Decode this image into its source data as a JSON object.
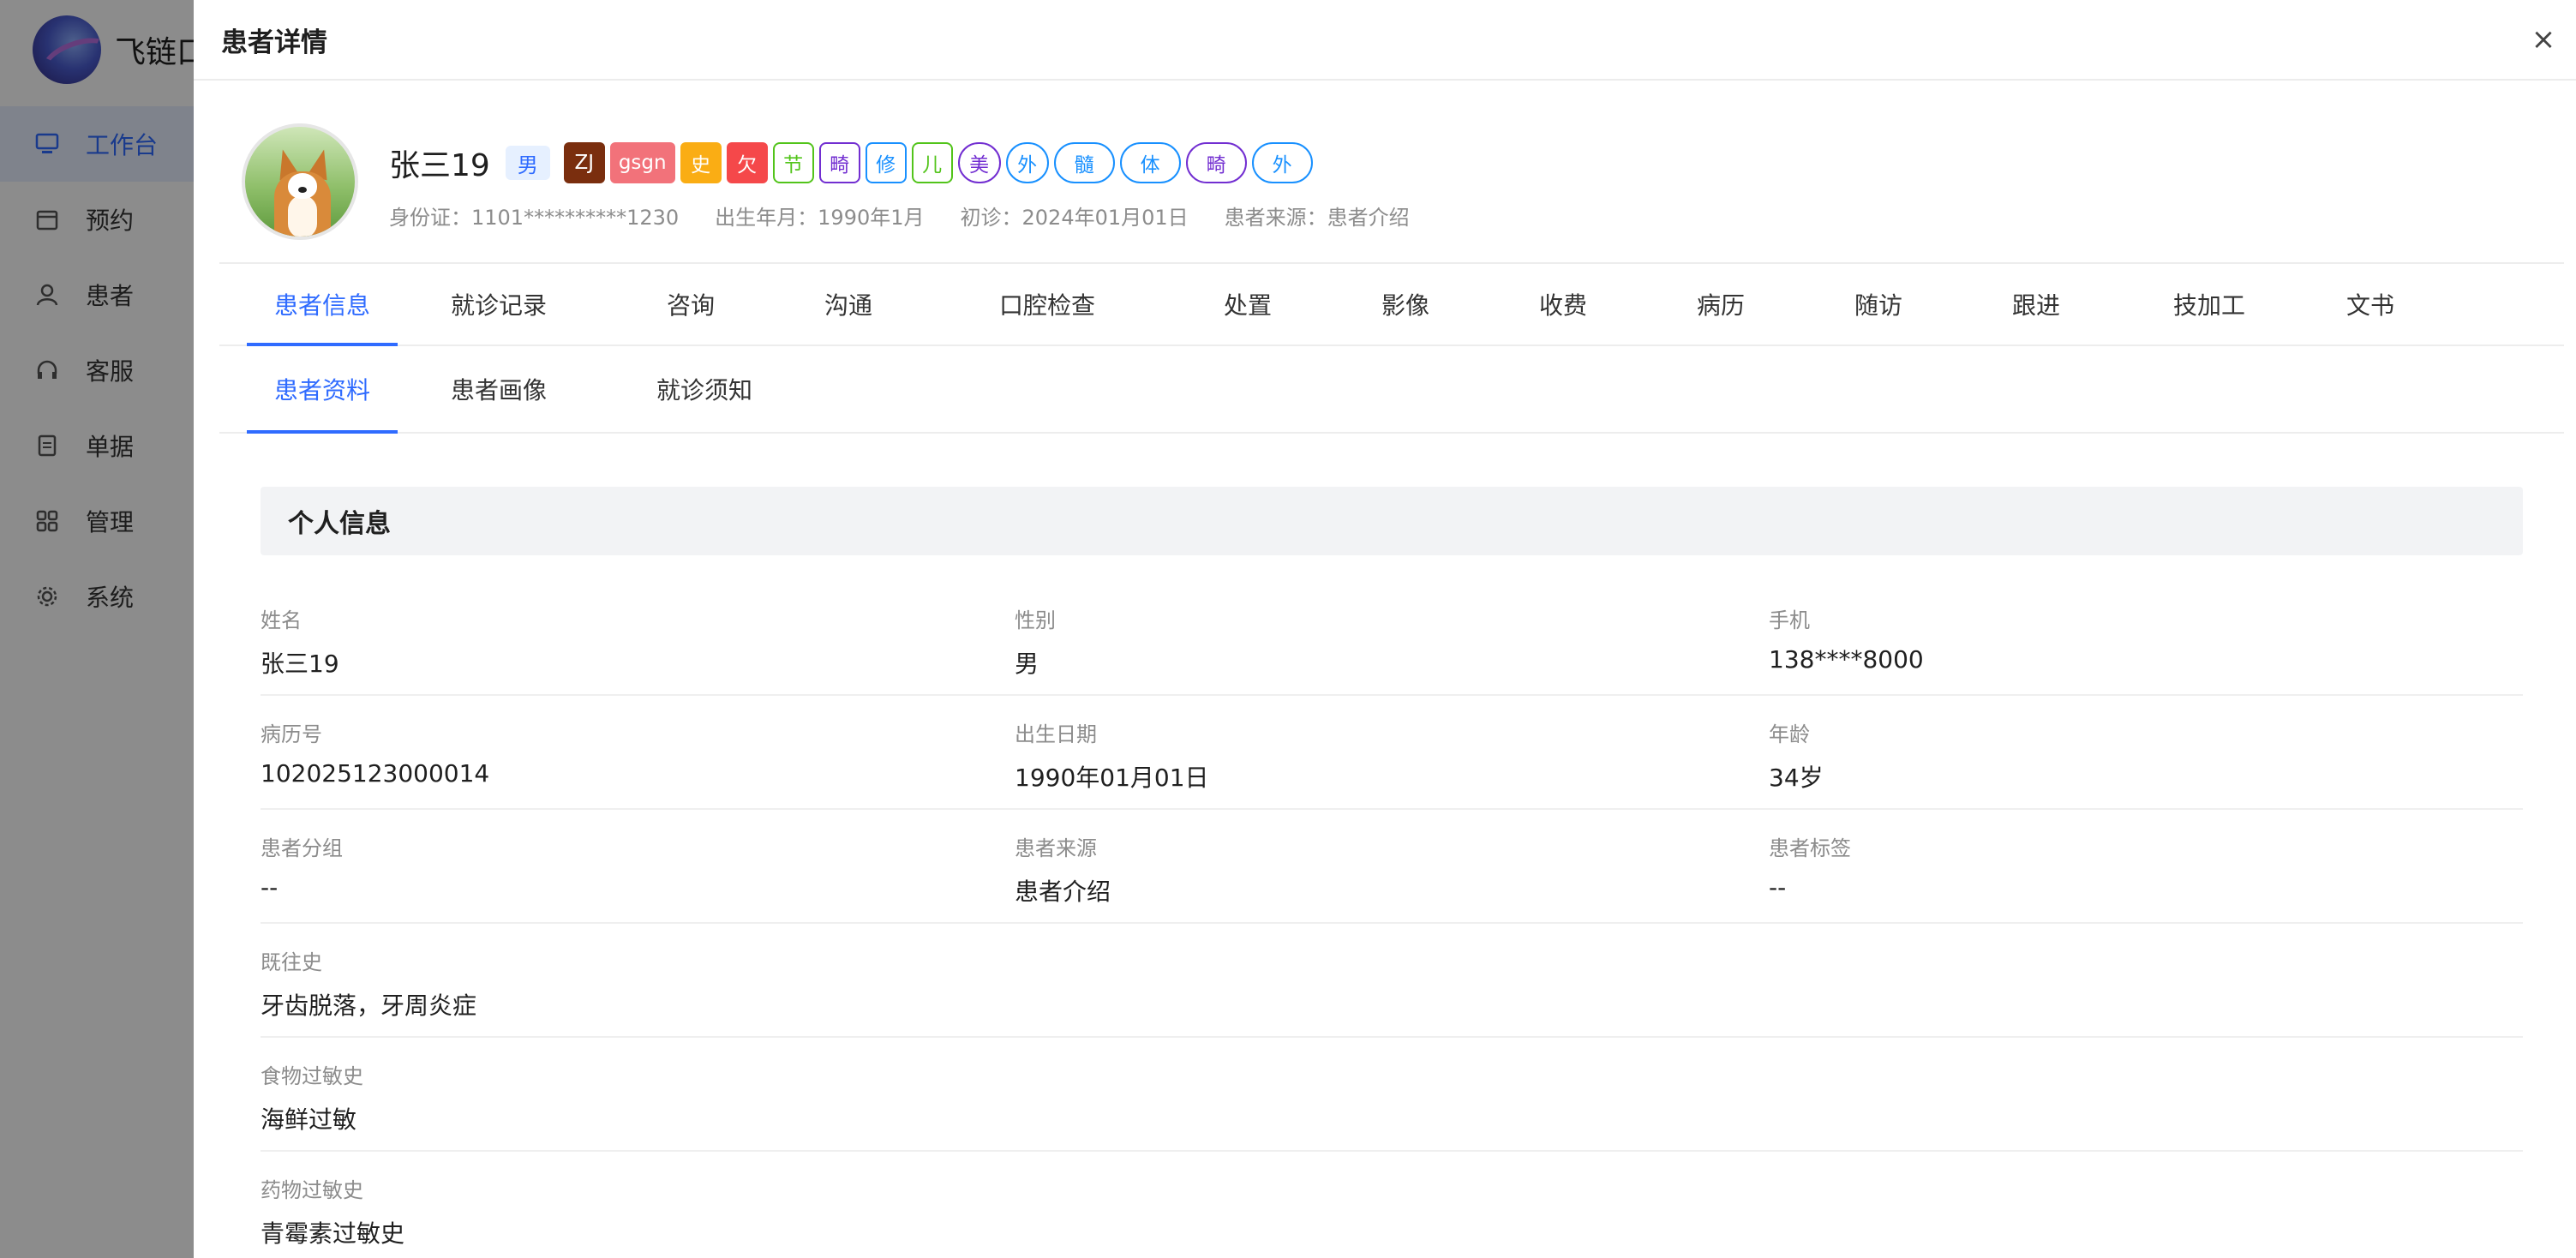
{
  "app": {
    "logo_text": "飞链口",
    "nav": [
      {
        "label": "工作台",
        "icon": "monitor-icon"
      },
      {
        "label": "预约",
        "icon": "calendar-icon"
      },
      {
        "label": "患者",
        "icon": "user-icon"
      },
      {
        "label": "客服",
        "icon": "headset-icon"
      },
      {
        "label": "单据",
        "icon": "document-icon"
      },
      {
        "label": "管理",
        "icon": "grid-icon"
      },
      {
        "label": "系统",
        "icon": "gear-icon"
      }
    ]
  },
  "drawer": {
    "title": "患者详情",
    "close_label": "×"
  },
  "patient": {
    "name": "张三19",
    "gender": "男",
    "tags": [
      {
        "text": "ZJ",
        "style": "solid",
        "color": "#7a2e0e"
      },
      {
        "text": "gsgn",
        "style": "solid",
        "color": "#f2727a"
      },
      {
        "text": "史",
        "style": "solid",
        "color": "#faad14"
      },
      {
        "text": "欠",
        "style": "solid",
        "color": "#f5484a"
      },
      {
        "text": "节",
        "style": "outline",
        "color": "#52c41a"
      },
      {
        "text": "畸",
        "style": "outline",
        "color": "#722ed1"
      },
      {
        "text": "修",
        "style": "outline",
        "color": "#1890ff"
      },
      {
        "text": "儿",
        "style": "outline",
        "color": "#52c41a"
      },
      {
        "text": "美",
        "style": "circle",
        "color": "#722ed1"
      },
      {
        "text": "外",
        "style": "circle",
        "color": "#1890ff"
      },
      {
        "text": "髓",
        "style": "pill",
        "color": "#1890ff"
      },
      {
        "text": "体",
        "style": "pill",
        "color": "#1890ff"
      },
      {
        "text": "畸",
        "style": "pill",
        "color": "#722ed1"
      },
      {
        "text": "外",
        "style": "pill",
        "color": "#1890ff"
      }
    ],
    "meta": {
      "id_card": "身份证：1101**********1230",
      "birth_month": "出生年月：1990年1月",
      "first_visit": "初诊：2024年01月01日",
      "source": "患者来源：患者介绍"
    }
  },
  "tabs": [
    {
      "label": "患者信息",
      "active": true
    },
    {
      "label": "就诊记录"
    },
    {
      "label": "咨询"
    },
    {
      "label": "沟通"
    },
    {
      "label": "口腔检查"
    },
    {
      "label": "处置"
    },
    {
      "label": "影像"
    },
    {
      "label": "收费"
    },
    {
      "label": "病历"
    },
    {
      "label": "随访"
    },
    {
      "label": "跟进"
    },
    {
      "label": "技加工"
    },
    {
      "label": "文书"
    }
  ],
  "subtabs": [
    {
      "label": "患者资料",
      "active": true
    },
    {
      "label": "患者画像"
    },
    {
      "label": "就诊须知"
    }
  ],
  "section": {
    "title": "个人信息",
    "fields": [
      {
        "label": "姓名",
        "value": "张三19"
      },
      {
        "label": "性别",
        "value": "男"
      },
      {
        "label": "手机",
        "value": "138****8000"
      },
      {
        "label": "病历号",
        "value": "102025123000014"
      },
      {
        "label": "出生日期",
        "value": "1990年01月01日"
      },
      {
        "label": "年龄",
        "value": "34岁"
      },
      {
        "label": "患者分组",
        "value": "--"
      },
      {
        "label": "患者来源",
        "value": "患者介绍"
      },
      {
        "label": "患者标签",
        "value": "--"
      },
      {
        "label": "既往史",
        "value": "牙齿脱落，牙周炎症"
      },
      {
        "label": "食物过敏史",
        "value": "海鲜过敏"
      },
      {
        "label": "药物过敏史",
        "value": "青霉素过敏史"
      }
    ]
  }
}
